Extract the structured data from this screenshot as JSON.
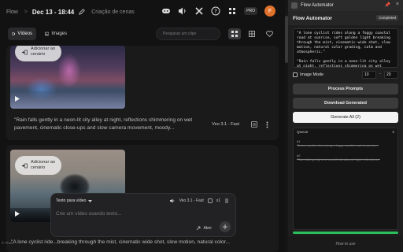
{
  "app": {
    "brand": "Flow",
    "separator": ">",
    "project_name": "Dec 13 - 18:44",
    "scene_link": "Criação de cenas",
    "pro_badge": "PRO",
    "avatar_initial": "F"
  },
  "toolbar": {
    "tab_videos": "Vídeos",
    "tab_images": "Images",
    "search_placeholder": "Pesquisar um clipe"
  },
  "cards": [
    {
      "add_label_1": "Adicionar ao",
      "add_label_2": "cenário",
      "prompt": "\"Rain falls gently in a neon-lit city alley at night, reflections shimmering on wet pavement, cinematic close-ups and slow camera movement, moody...",
      "model": "Veo 3.1 - Fast"
    },
    {
      "add_label_1": "Adicionar ao",
      "add_label_2": "cenário"
    }
  ],
  "composer": {
    "mode_label": "Texto para vídeo",
    "model_label": "Veo 3.1 - Fast",
    "count_label": "x1",
    "placeholder": "Crie um vídeo usando texto...",
    "open_label": "Abrir"
  },
  "bottom_prompt": "\"A lone cyclist ride...breaking through the mist, cinematic wide shot, slow motion, natural color...",
  "watermark": "© Flow",
  "panel": {
    "window_title": "Flow Automator",
    "header": "Flow Automator",
    "status": "Completed",
    "prompts_text": "\"A lone cyclist rides along a foggy coastal road at sunrise, soft golden light breaking through the mist, cinematic wide shot, slow motion, natural color grading, calm and atmospheric.\"\n\n\"Rain falls gently in a neon-lit city alley at night, reflections shimmering on wet",
    "image_mode_label": "Image Mode",
    "range_start": "10",
    "range_end": "20",
    "process_prompts": "Process Prompts",
    "download_generated": "Download Generated",
    "generate_all": "Generate All (2)",
    "queue_label": "Queue",
    "queue_count": "2",
    "queue_items": [
      {
        "num": "#1",
        "text": "\"A lone cyclist rides along a foggy coastal road at sunrise..."
      },
      {
        "num": "#2",
        "text": "\"Rain falls gently in a neon-lit city alley at night, reflections..."
      }
    ],
    "progress": 1.0,
    "howto": "How to use",
    "accent_green": "#2bbf5a"
  },
  "icons": [
    "pencil-icon",
    "discord-icon",
    "volume-icon",
    "x-logo-icon",
    "help-icon",
    "grid-icon",
    "list-icon",
    "heart-icon",
    "video-icon",
    "image-icon",
    "play-icon",
    "add-to-scene-icon",
    "more-icon",
    "pin-icon",
    "close-icon",
    "send-icon"
  ]
}
